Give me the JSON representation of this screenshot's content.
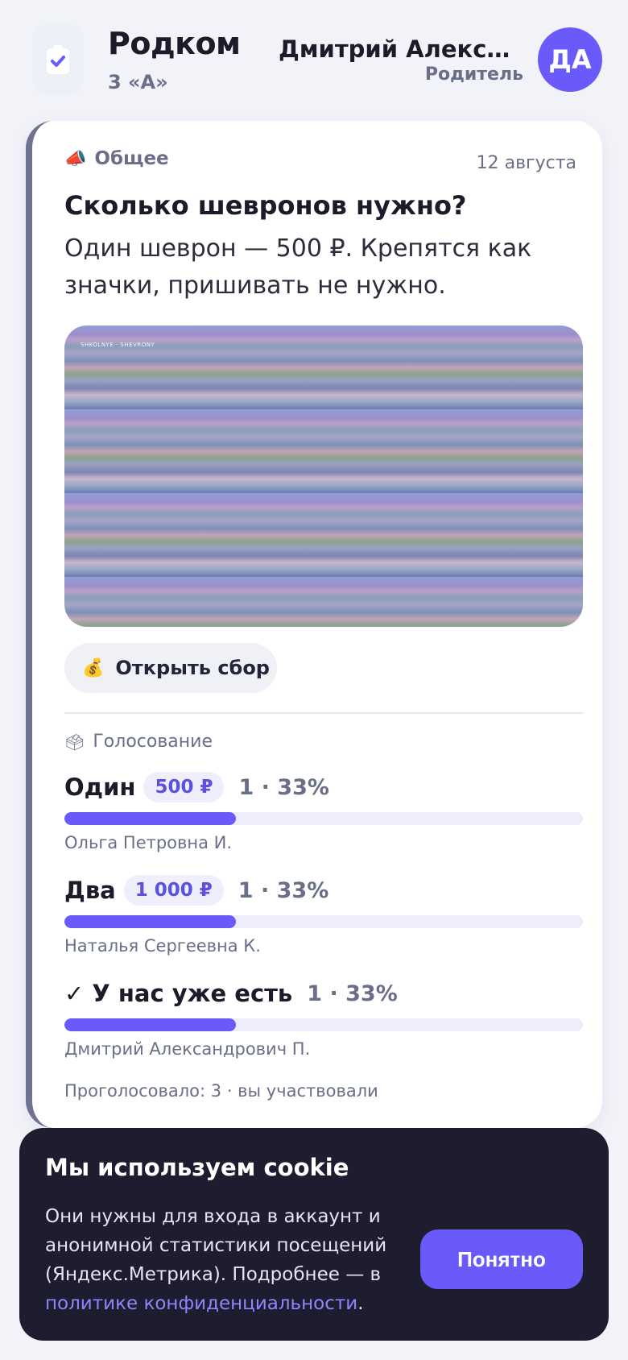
{
  "header": {
    "app_title": "Родком",
    "class_name": "3 «А»",
    "user_name": "Дмитрий Александрович П.",
    "user_role": "Родитель",
    "avatar_initials": "ДА"
  },
  "post": {
    "category": "Общее",
    "date": "12 августа",
    "title": "Сколько шевронов нужно?",
    "text": "Один шеврон — 500 ₽. Крепятся как значки, пришивать не нужно.",
    "image_caption": "SHKOLNYE · SHEVRONY",
    "open_collect_label": "Открыть сбор"
  },
  "poll": {
    "label": "Голосование",
    "options": [
      {
        "title": "Один",
        "price": "500 ₽",
        "stats": "1 · 33%",
        "percent": 33,
        "voter": "Ольга Петровна И."
      },
      {
        "title": "Два",
        "price": "1 000 ₽",
        "stats": "1 · 33%",
        "percent": 33,
        "voter": "Наталья Сергеевна К."
      },
      {
        "title": "✓ У нас уже есть",
        "stats": "1 · 33%",
        "percent": 33,
        "voter": "Дмитрий Александрович П."
      }
    ],
    "summary": "Проголосовало: 3 · вы участвовали"
  },
  "cookie": {
    "title": "Мы используем cookie",
    "text": "Они нужны для входа в аккаунт и анонимной статистики посещений (Яндекс.Метрика). Подробнее — в ",
    "link": "политике конфиденциальности",
    "text_end": ".",
    "button": "Понятно"
  },
  "colors": {
    "accent": "#6a5af9",
    "background": "#f2f3f9",
    "cookie_bg": "#1d1d2f"
  }
}
